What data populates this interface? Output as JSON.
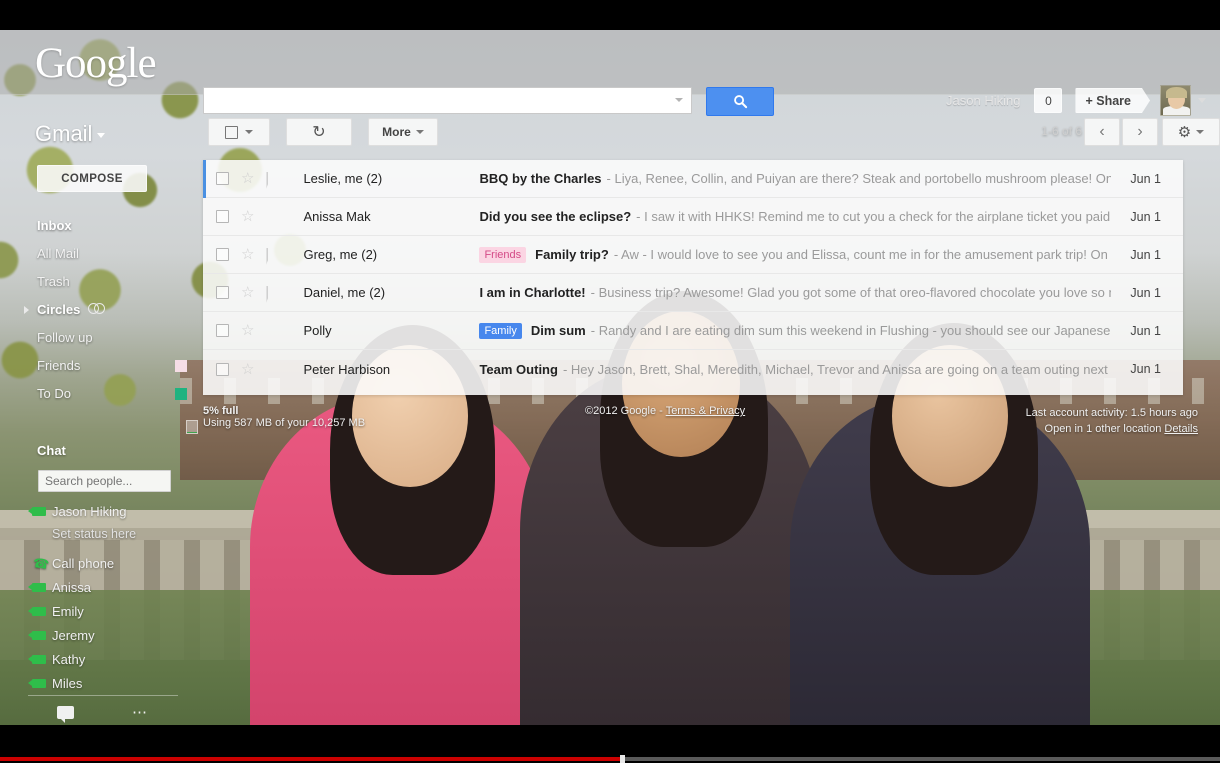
{
  "google_bar": {
    "logo": "Google",
    "search_value": "",
    "search_placeholder": "",
    "search_icon": "search-icon",
    "user_name": "Jason Hiking",
    "notification_count": "0",
    "share_label": "+ Share",
    "avatar": "user-avatar"
  },
  "sidebar": {
    "app_title": "Gmail",
    "compose_label": "COMPOSE",
    "nav_items": [
      {
        "label": "Inbox",
        "bold": true,
        "swatch": ""
      },
      {
        "label": "All Mail",
        "bold": false,
        "swatch": ""
      },
      {
        "label": "Trash",
        "bold": false,
        "swatch": ""
      },
      {
        "label": "Circles",
        "bold": true,
        "swatch": "",
        "expandable": true,
        "icon": "circles-icon"
      },
      {
        "label": "Follow up",
        "bold": false,
        "swatch": ""
      },
      {
        "label": "Friends",
        "bold": false,
        "swatch": "#f6dde6"
      },
      {
        "label": "To Do",
        "bold": false,
        "swatch": "#1fb380"
      }
    ],
    "chat": {
      "heading": "Chat",
      "search_value": "",
      "search_placeholder": "Search people...",
      "me": "Jason Hiking",
      "status_placeholder": "Set status here",
      "call_phone": "Call phone",
      "contacts": [
        "Anissa",
        "Emily",
        "Jeremy",
        "Kathy",
        "Miles"
      ]
    }
  },
  "toolbar": {
    "select_all": "select-all-checkbox",
    "refresh": "↻",
    "more_label": "More",
    "pager": "1-6 of 6",
    "prev": "‹",
    "next": "›",
    "gear": "⚙"
  },
  "messages": [
    {
      "selected": true,
      "sender": "Leslie, me (2)",
      "important": false,
      "chip": "",
      "subject": "BBQ by the Charles",
      "snippet": "- Liya, Renee, Collin, and Puiyan are there? Steak and portobello mushroom please! On Fr",
      "date": "Jun 1"
    },
    {
      "selected": false,
      "sender": "Anissa Mak",
      "important": true,
      "chip": "",
      "subject": "Did you see the eclipse?",
      "snippet": "- I saw it with HHKS! Remind me to cut you a check for the airplane ticket you paid fo",
      "date": "Jun 1"
    },
    {
      "selected": false,
      "sender": "Greg, me (2)",
      "important": false,
      "chip": "Friends",
      "chip_type": "friends",
      "subject": "Family trip?",
      "snippet": "- Aw - I would love to see you and Elissa, count me in for the amusement park trip! On F",
      "date": "Jun 1"
    },
    {
      "selected": false,
      "sender": "Daniel, me (2)",
      "important": false,
      "chip": "",
      "subject": "I am in Charlotte!",
      "snippet": "- Business trip? Awesome! Glad you got some of that oreo-flavored chocolate you love so mu",
      "date": "Jun 1"
    },
    {
      "selected": false,
      "sender": "Polly",
      "important": true,
      "chip": "Family",
      "chip_type": "family",
      "subject": "Dim sum",
      "snippet": "- Randy and I are eating dim sum this weekend in Flushing - you should see our Japanese m",
      "date": "Jun 1"
    },
    {
      "selected": false,
      "sender": "Peter Harbison",
      "important": true,
      "chip": "",
      "subject": "Team Outing",
      "snippet": "- Hey Jason, Brett, Shal, Meredith, Michael, Trevor and Anissa are going on a team outing next w",
      "date": "Jun 1"
    }
  ],
  "footer": {
    "storage_percent": "5% full",
    "storage_detail": "Using 587 MB of your 10,257 MB",
    "copyright": "©2012 Google - ",
    "terms_link": "Terms & Privacy",
    "activity": "Last account activity: 1.5 hours ago",
    "location": "Open in 1 other location ",
    "details_link": "Details"
  },
  "player": {
    "progress_percent": 51
  },
  "colors": {
    "accent_blue": "#4d90f0",
    "label_family": "#4787ed",
    "label_friends": "#fbd5e3",
    "important_yellow": "#fbc63f",
    "progress_red": "#cc0000",
    "chat_green": "#2fbd4a"
  }
}
